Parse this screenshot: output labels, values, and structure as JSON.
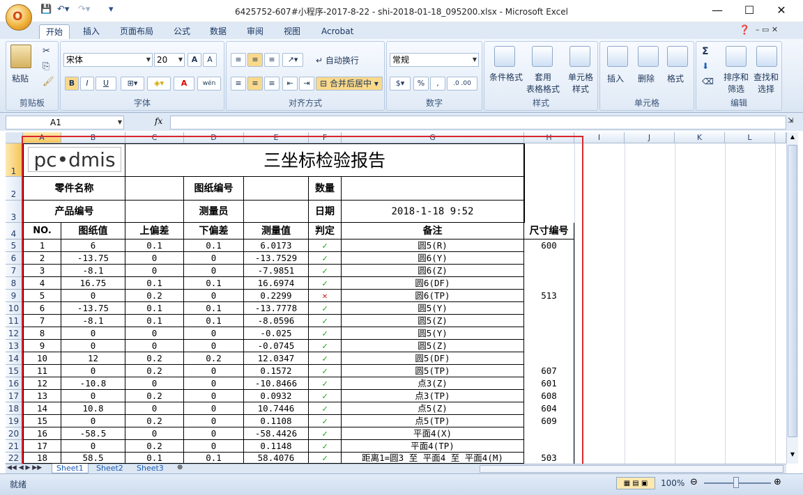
{
  "app": {
    "title": "6425752-607#小程序-2017-8-22 - shi-2018-01-18_095200.xlsx - Microsoft Excel",
    "office_button": "O"
  },
  "tabs": [
    "开始",
    "插入",
    "页面布局",
    "公式",
    "数据",
    "审阅",
    "视图",
    "Acrobat"
  ],
  "ribbon": {
    "clipboard": {
      "paste": "粘贴",
      "label": "剪贴板"
    },
    "font": {
      "name": "宋体",
      "size": "20",
      "bold": "B",
      "italic": "I",
      "underline": "U",
      "label": "字体",
      "grow": "A",
      "shrink": "A",
      "color": "A",
      "phonetic": "wén"
    },
    "alignment": {
      "wrap": "自动换行",
      "merge": "合并后居中",
      "label": "对齐方式"
    },
    "number": {
      "format": "常规",
      "percent": "%",
      "comma": ",",
      "inc": ".0 .00",
      "label": "数字"
    },
    "styles": {
      "conditional": "条件格式",
      "table": "套用\n表格格式",
      "cell": "单元格\n样式",
      "label": "样式"
    },
    "cells": {
      "insert": "插入",
      "delete": "删除",
      "format": "格式",
      "label": "单元格"
    },
    "editing": {
      "sum": "Σ",
      "sort": "排序和\n筛选",
      "find": "查找和\n选择",
      "label": "编辑"
    }
  },
  "formula_bar": {
    "name_box": "A1",
    "fx": "fx",
    "content": ""
  },
  "columns": [
    "A",
    "B",
    "C",
    "D",
    "E",
    "F",
    "G",
    "H",
    "I",
    "J",
    "K",
    "L"
  ],
  "rows": [
    "1",
    "2",
    "3",
    "4",
    "5",
    "6",
    "7",
    "8",
    "9",
    "10",
    "11",
    "12",
    "13",
    "14",
    "15",
    "16",
    "17",
    "18",
    "19",
    "20",
    "21",
    "22"
  ],
  "report": {
    "logo": "pc•dmis",
    "title": "三坐标检验报告",
    "part_name_label": "零件名称",
    "drawing_no_label": "图纸编号",
    "qty_label": "数量",
    "product_no_label": "产品编号",
    "inspector_label": "测量员",
    "date_label": "日期",
    "date_value": "2018-1-18 9:52",
    "headers": [
      "NO.",
      "图纸值",
      "上偏差",
      "下偏差",
      "测量值",
      "判定",
      "备注",
      "尺寸编号"
    ],
    "rows": [
      [
        "1",
        "6",
        "0.1",
        "0.1",
        "6.0173",
        "✓",
        "圆5(R)",
        "600"
      ],
      [
        "2",
        "-13.75",
        "0",
        "0",
        "-13.7529",
        "✓",
        "圆6(Y)",
        ""
      ],
      [
        "3",
        "-8.1",
        "0",
        "0",
        "-7.9851",
        "✓",
        "圆6(Z)",
        ""
      ],
      [
        "4",
        "16.75",
        "0.1",
        "0.1",
        "16.6974",
        "✓",
        "圆6(DF)",
        ""
      ],
      [
        "5",
        "0",
        "0.2",
        "0",
        "0.2299",
        "✕",
        "圆6(TP)",
        "513"
      ],
      [
        "6",
        "-13.75",
        "0.1",
        "0.1",
        "-13.7778",
        "✓",
        "圆5(Y)",
        ""
      ],
      [
        "7",
        "-8.1",
        "0.1",
        "0.1",
        "-8.0596",
        "✓",
        "圆5(Z)",
        ""
      ],
      [
        "8",
        "0",
        "0",
        "0",
        "-0.025",
        "✓",
        "圆5(Y)",
        ""
      ],
      [
        "9",
        "0",
        "0",
        "0",
        "-0.0745",
        "✓",
        "圆5(Z)",
        ""
      ],
      [
        "10",
        "12",
        "0.2",
        "0.2",
        "12.0347",
        "✓",
        "圆5(DF)",
        ""
      ],
      [
        "11",
        "0",
        "0.2",
        "0",
        "0.1572",
        "✓",
        "圆5(TP)",
        "607"
      ],
      [
        "12",
        "-10.8",
        "0",
        "0",
        "-10.8466",
        "✓",
        "点3(Z)",
        "601"
      ],
      [
        "13",
        "0",
        "0.2",
        "0",
        "0.0932",
        "✓",
        "点3(TP)",
        "608"
      ],
      [
        "14",
        "10.8",
        "0",
        "0",
        "10.7446",
        "✓",
        "点5(Z)",
        "604"
      ],
      [
        "15",
        "0",
        "0.2",
        "0",
        "0.1108",
        "✓",
        "点5(TP)",
        "609"
      ],
      [
        "16",
        "-58.5",
        "0",
        "0",
        "-58.4426",
        "✓",
        "平面4(X)",
        ""
      ],
      [
        "17",
        "0",
        "0.2",
        "0",
        "0.1148",
        "✓",
        "平面4(TP)",
        ""
      ],
      [
        "18",
        "58.5",
        "0.1",
        "0.1",
        "58.4076",
        "✓",
        "距离1=圆3 至 平面4 至 平面4(M)",
        "503"
      ]
    ]
  },
  "sheets": [
    "Sheet1",
    "Sheet2",
    "Sheet3"
  ],
  "status": {
    "ready": "就绪",
    "zoom": "100%"
  },
  "colors": {
    "ok": "#1ba31b",
    "ng": "#e01818",
    "highlight_box": "#d9262c"
  }
}
